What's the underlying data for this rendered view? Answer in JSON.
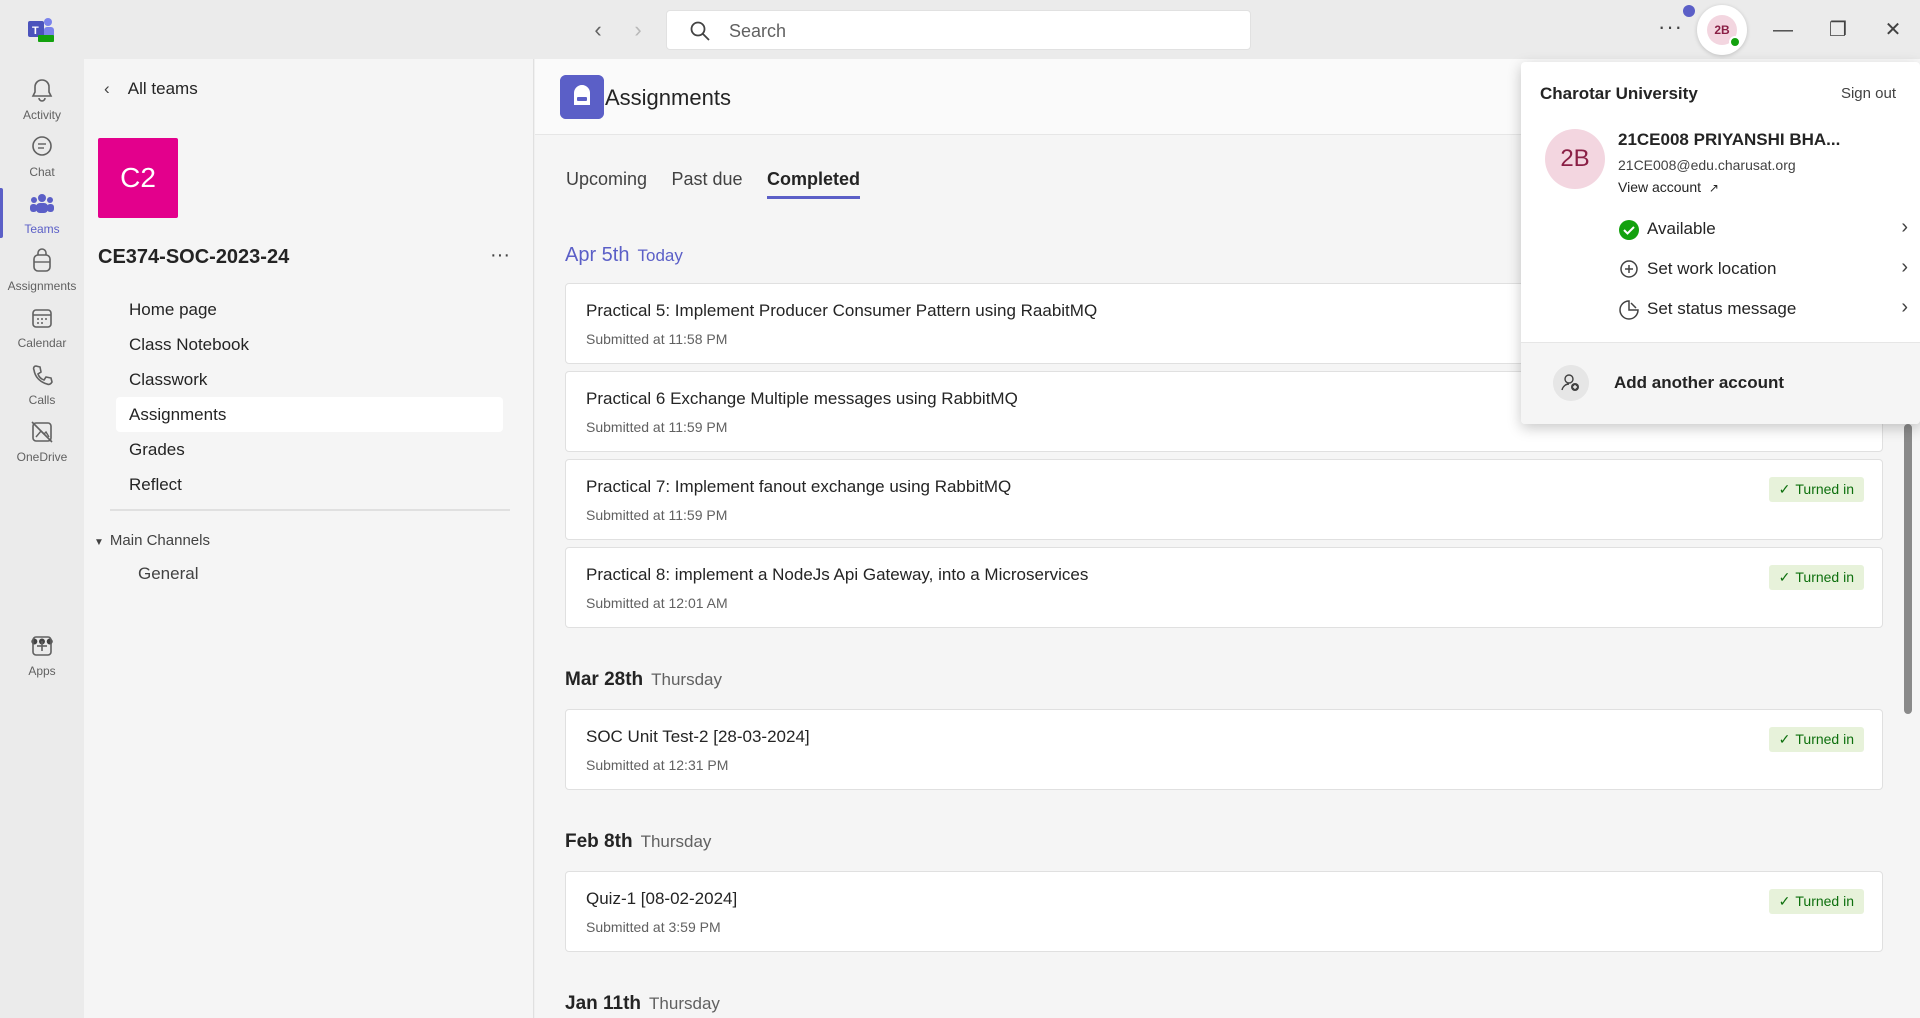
{
  "titlebar": {
    "search_placeholder": "Search",
    "more": "···",
    "user_initials": "2B"
  },
  "appbar": {
    "items": [
      {
        "label": "Activity",
        "icon": "bell-icon"
      },
      {
        "label": "Chat",
        "icon": "chat-icon"
      },
      {
        "label": "Teams",
        "icon": "teams-icon"
      },
      {
        "label": "Assignments",
        "icon": "backpack-icon"
      },
      {
        "label": "Calendar",
        "icon": "calendar-icon"
      },
      {
        "label": "Calls",
        "icon": "phone-icon"
      },
      {
        "label": "OneDrive",
        "icon": "onedrive-icon"
      },
      {
        "label": "Apps",
        "icon": "add-app-icon"
      }
    ],
    "more": "•••"
  },
  "teampane": {
    "back_label": "All teams",
    "tile": "C2",
    "team_name": "CE374-SOC-2023-24",
    "more": "···",
    "nav": [
      {
        "label": "Home page"
      },
      {
        "label": "Class Notebook"
      },
      {
        "label": "Classwork"
      },
      {
        "label": "Assignments"
      },
      {
        "label": "Grades"
      },
      {
        "label": "Reflect"
      }
    ],
    "channels_header": "Main Channels",
    "channel": "General"
  },
  "main": {
    "title": "Assignments",
    "tabs": [
      {
        "label": "Upcoming"
      },
      {
        "label": "Past due"
      },
      {
        "label": "Completed"
      }
    ],
    "groups": [
      {
        "date": "Apr 5th",
        "weekday": "Today",
        "cards": [
          {
            "title": "Practical 5: Implement Producer Consumer Pattern using RaabitMQ",
            "submitted": "Submitted at 11:58 PM",
            "status": ""
          },
          {
            "title": "Practical 6 Exchange Multiple messages using RabbitMQ",
            "submitted": "Submitted at 11:59 PM",
            "status": ""
          },
          {
            "title": "Practical 7: Implement fanout exchange using RabbitMQ",
            "submitted": "Submitted at 11:59 PM",
            "status": "Turned in"
          },
          {
            "title": "Practical 8: implement a NodeJs Api Gateway, into a Microservices",
            "submitted": "Submitted at 12:01 AM",
            "status": "Turned in"
          }
        ]
      },
      {
        "date": "Mar 28th",
        "weekday": "Thursday",
        "cards": [
          {
            "title": "SOC Unit Test-2 [28-03-2024]",
            "submitted": "Submitted at 12:31 PM",
            "status": "Turned in"
          }
        ]
      },
      {
        "date": "Feb 8th",
        "weekday": "Thursday",
        "cards": [
          {
            "title": "Quiz-1 [08-02-2024]",
            "submitted": "Submitted at 3:59 PM",
            "status": "Turned in"
          }
        ]
      },
      {
        "date": "Jan 11th",
        "weekday": "Thursday",
        "cards": []
      }
    ]
  },
  "flyout": {
    "org": "Charotar University",
    "sign_out": "Sign out",
    "avatar": "2B",
    "name": "21CE008 PRIYANSHI BHA...",
    "email": "21CE008@edu.charusat.org",
    "view_account": "View account",
    "rows": [
      {
        "label": "Available",
        "icon": "available-check-icon"
      },
      {
        "label": "Set work location",
        "icon": "location-icon"
      },
      {
        "label": "Set status message",
        "icon": "status-message-icon"
      }
    ],
    "add_account": "Add another account"
  },
  "colors": {
    "accent": "#5b5fc7",
    "team_tile": "#e3008c",
    "turned_in_bg": "#e7f2da",
    "turned_in_text": "#0e700e",
    "presence": "#13a10e"
  }
}
